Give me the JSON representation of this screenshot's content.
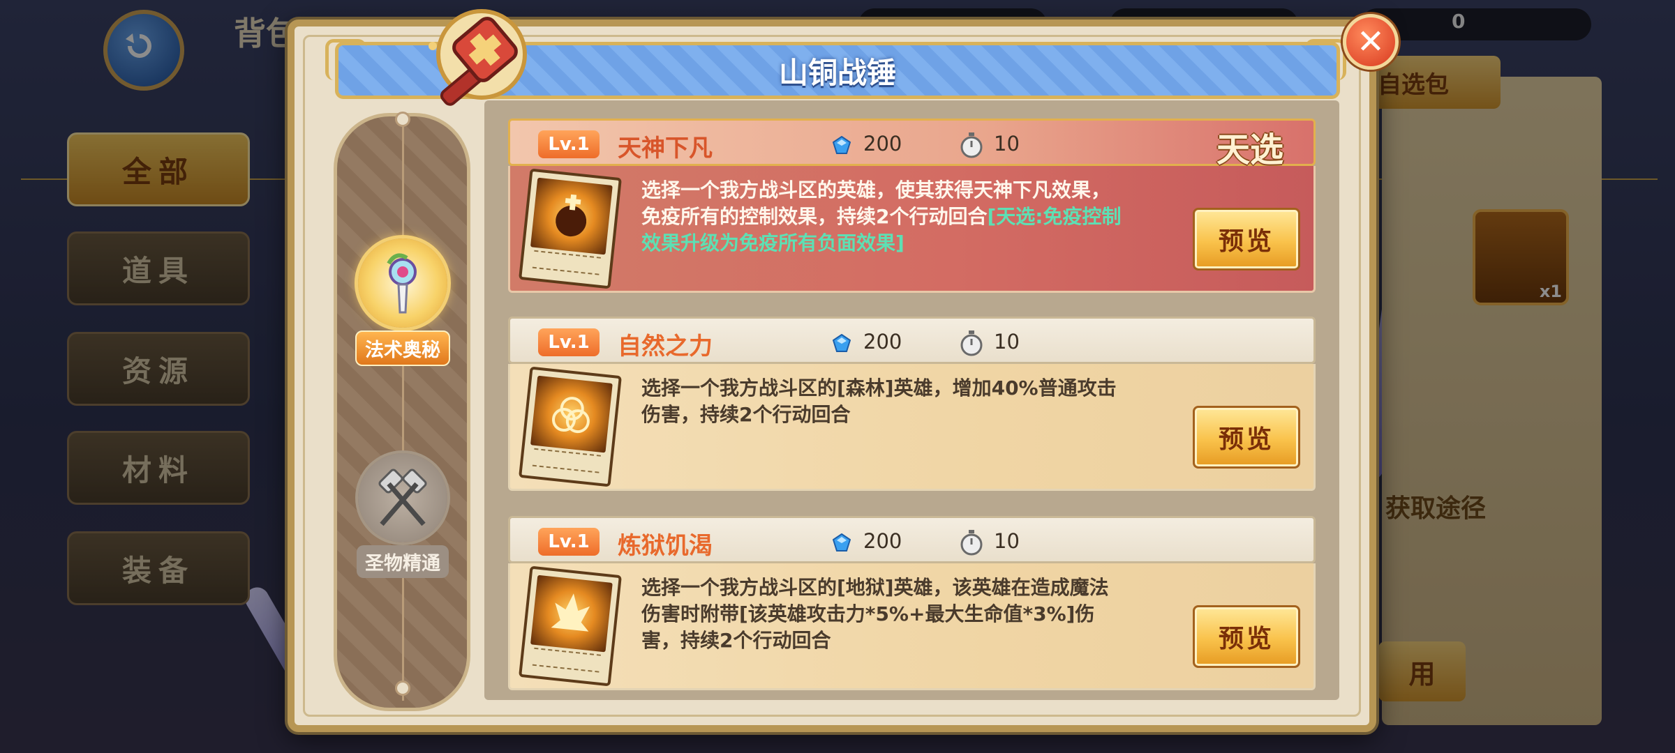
{
  "background": {
    "title": "背包",
    "top_count": "0",
    "tabs": [
      {
        "label": "全部",
        "active": true
      },
      {
        "label": "道具",
        "active": false
      },
      {
        "label": "资源",
        "active": false
      },
      {
        "label": "材料",
        "active": false
      },
      {
        "label": "装备",
        "active": false
      }
    ],
    "gift_button": "自选包",
    "item_qty": "x1",
    "acquire_text": "获取途径",
    "use_button": "用"
  },
  "modal": {
    "title": "山铜战锤",
    "close_icon": "close-x-icon"
  },
  "schools": [
    {
      "label": "法术奥秘",
      "icon": "magic-staff-icon",
      "active": true
    },
    {
      "label": "圣物精通",
      "icon": "crossed-hammers-icon",
      "active": false
    }
  ],
  "skills": [
    {
      "level": "Lv.1",
      "name": "天神下凡",
      "cost": "200",
      "cost_icon": "mana-gem-icon",
      "cooldown": "10",
      "cooldown_icon": "stopwatch-icon",
      "tag": "天选",
      "desc": "选择一个我方战斗区的英雄，使其获得天神下凡效果，免疫所有的控制效果，持续2个行动回合",
      "highlight": "[天选:免疫控制效果升级为免疫所有负面效果]",
      "preview": "预览",
      "special": true
    },
    {
      "level": "Lv.1",
      "name": "自然之力",
      "cost": "200",
      "cost_icon": "mana-gem-icon",
      "cooldown": "10",
      "cooldown_icon": "stopwatch-icon",
      "desc": "选择一个我方战斗区的[森林]英雄，增加40%普通攻击伤害，持续2个行动回合",
      "preview": "预览",
      "special": false
    },
    {
      "level": "Lv.1",
      "name": "炼狱饥渴",
      "cost": "200",
      "cost_icon": "mana-gem-icon",
      "cooldown": "10",
      "cooldown_icon": "stopwatch-icon",
      "desc": "选择一个我方战斗区的[地狱]英雄，该英雄在造成魔法伤害时附带[该英雄攻击力*5%+最大生命值*3%]伤害，持续2个行动回合",
      "preview": "预览",
      "special": false
    }
  ],
  "colors": {
    "accent_orange": "#e8692c",
    "highlight_teal": "#5de0b4",
    "title_blue": "#7fb0ee",
    "gold_border": "#d8b25a"
  }
}
